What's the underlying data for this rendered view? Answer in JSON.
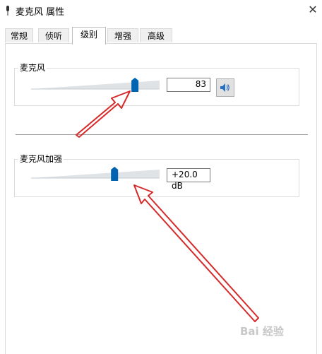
{
  "window": {
    "title": "麦克风 属性",
    "icon": "microphone-icon",
    "close_icon": "close-icon",
    "close_glyph": "✕"
  },
  "tabs": [
    {
      "label": "常规"
    },
    {
      "label": "侦听"
    },
    {
      "label": "级别",
      "selected": true
    },
    {
      "label": "增强"
    },
    {
      "label": "高级"
    }
  ],
  "microphone": {
    "label": "麦克风",
    "value": "83",
    "level_percent": 83,
    "mute_icon": "speaker-icon"
  },
  "boost": {
    "label": "麦克风加强",
    "value": "+20.0 dB",
    "level_percent": 66
  },
  "watermark": {
    "text": "Bai 经验"
  },
  "colors": {
    "accent": "#0063b1",
    "arrow": "#d62a2a"
  }
}
